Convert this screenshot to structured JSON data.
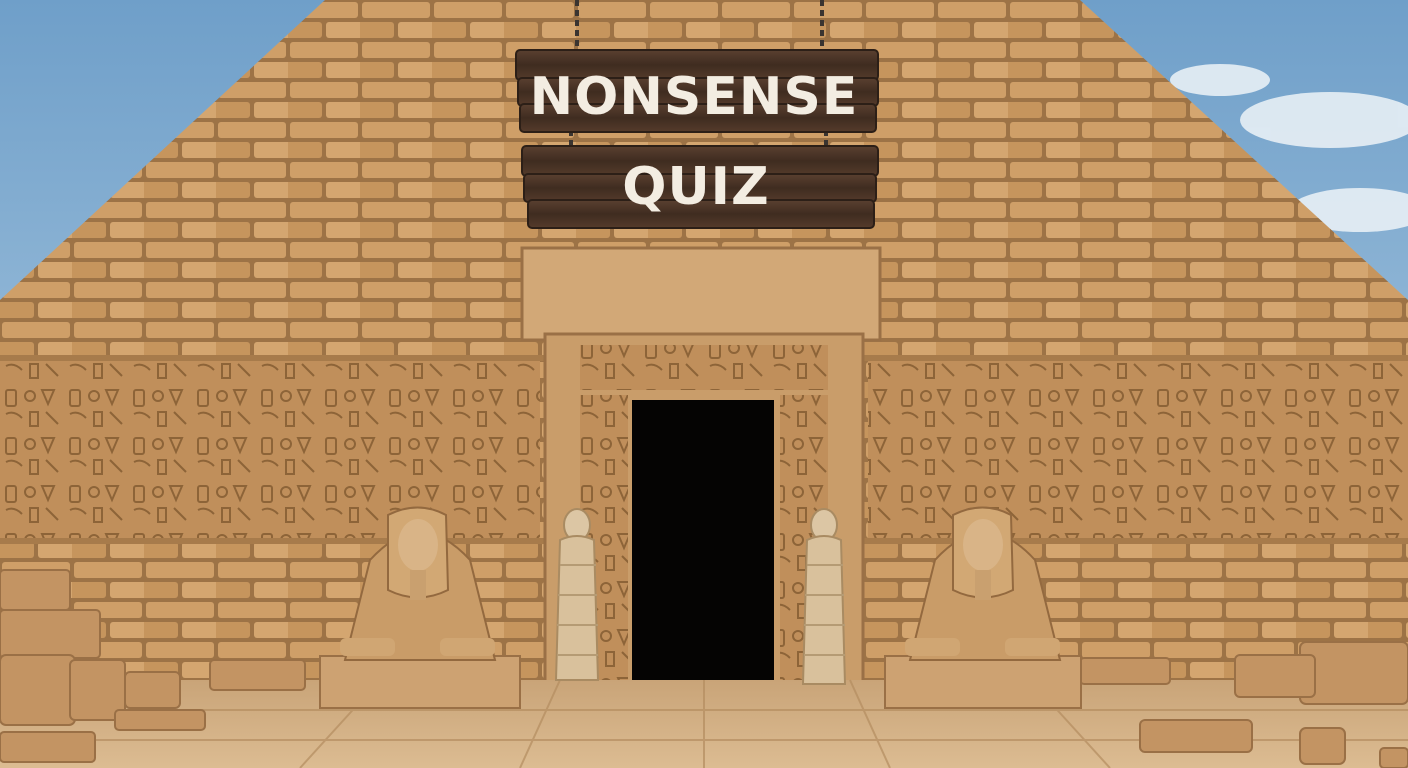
{
  "title_sign": {
    "line1": "NONSENSE",
    "line2": "QUIZ"
  },
  "colors": {
    "sky": "#8fb6d6",
    "stone": "#c79a64",
    "stone_light": "#d8b07c",
    "mortar": "#9d7346",
    "sign_wood": "#4a3426",
    "sign_text": "#f3ede2",
    "doorway": "#050403"
  },
  "scene": {
    "setting": "pyramid-entrance",
    "entrance": "dark-doorway",
    "guardians": [
      "sphinx-left",
      "mummy-left",
      "mummy-right",
      "sphinx-right"
    ]
  }
}
